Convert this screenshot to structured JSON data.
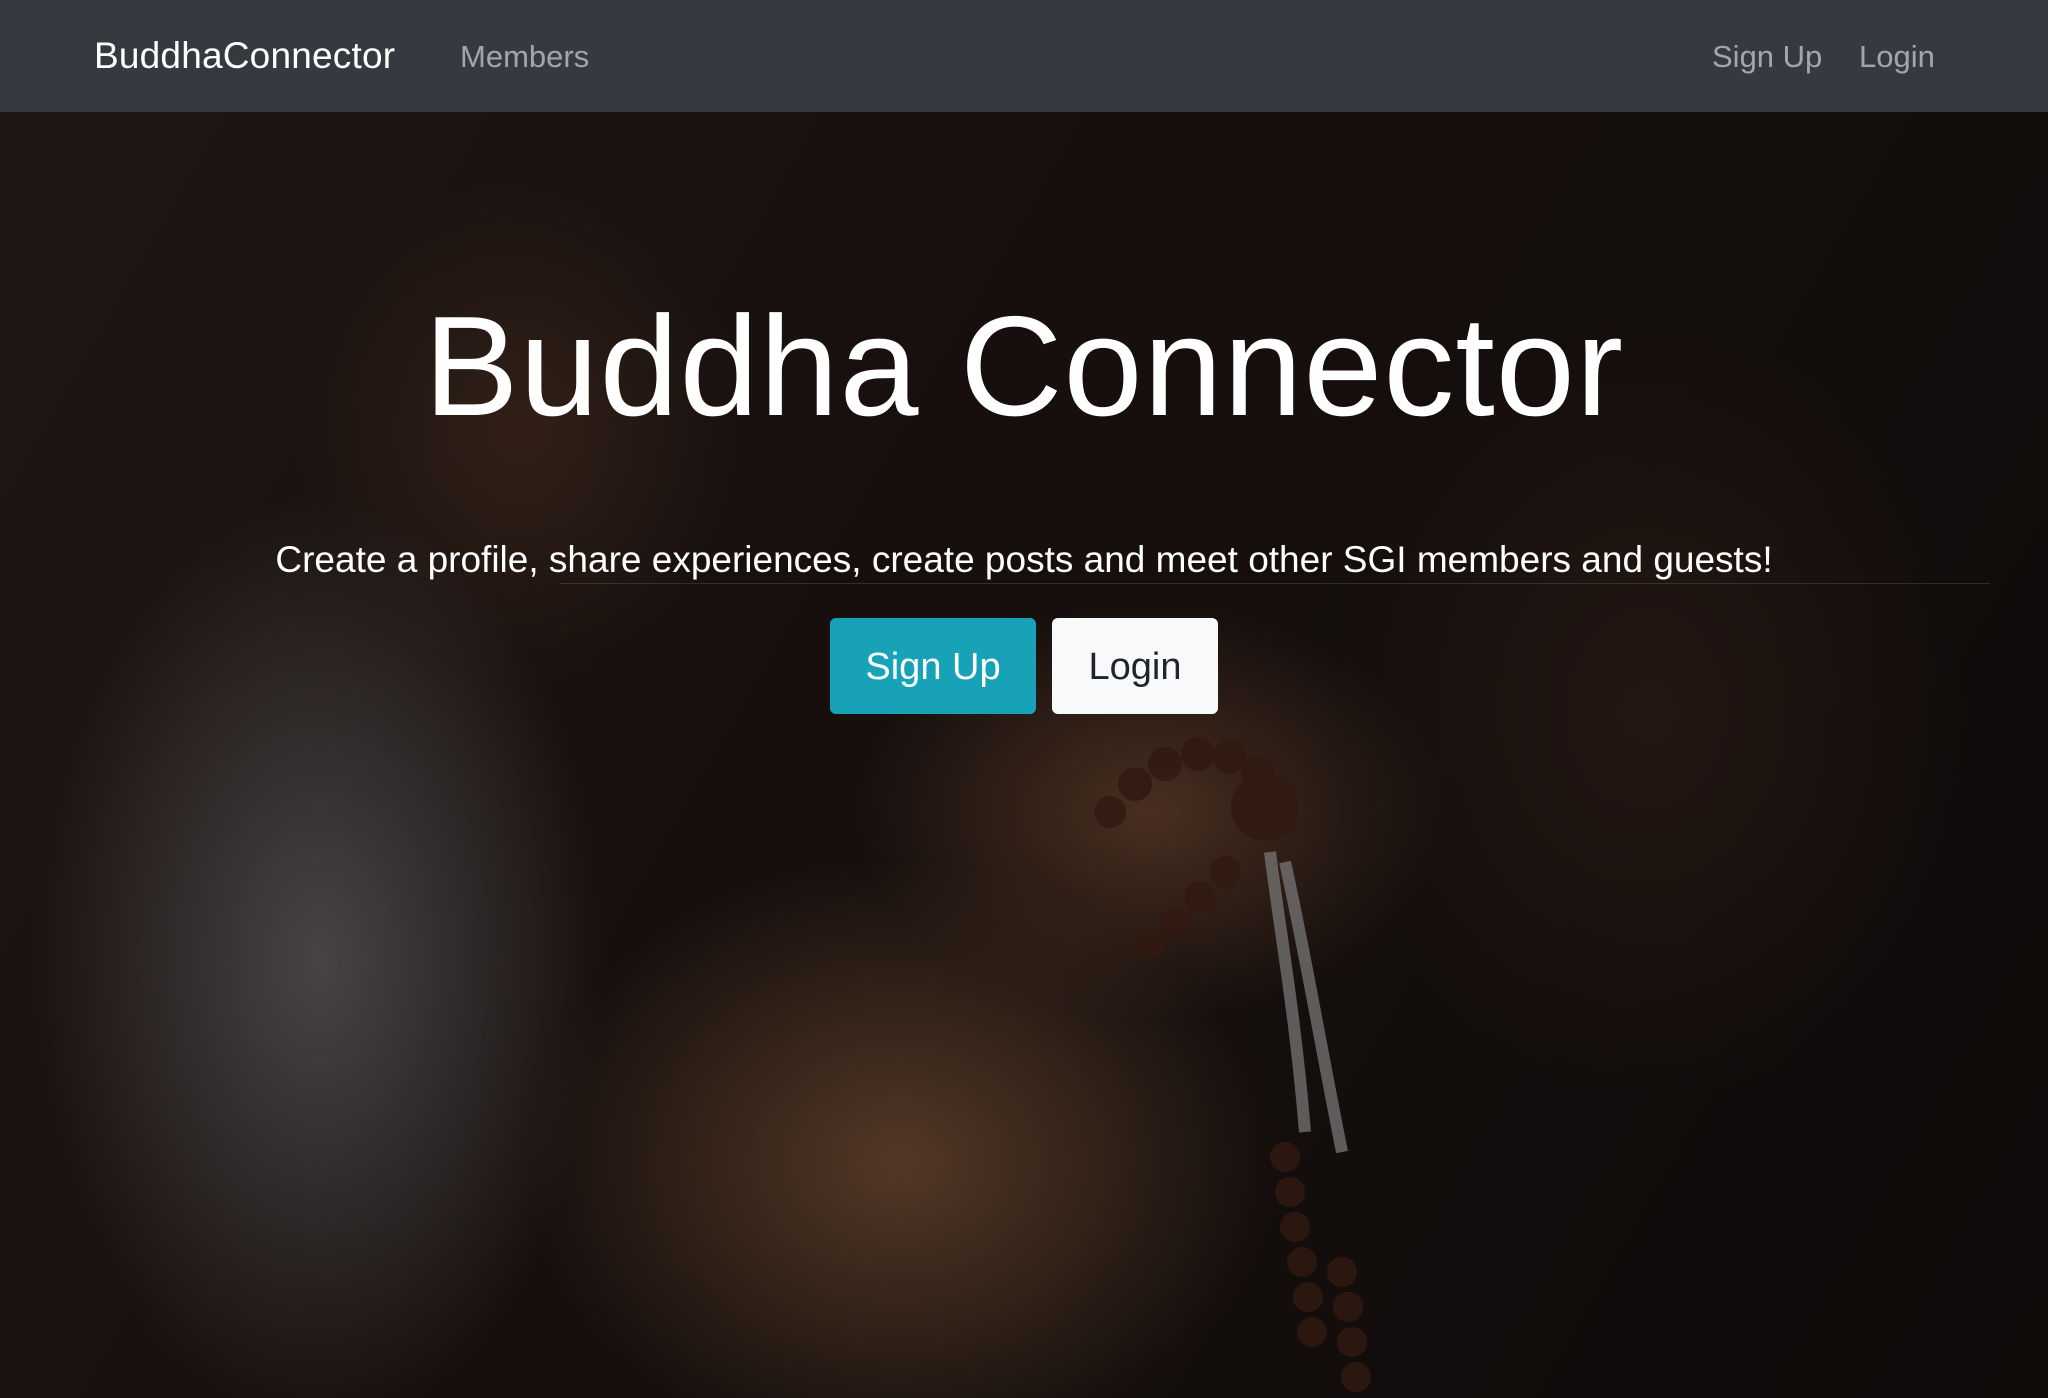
{
  "navbar": {
    "brand": "BuddhaConnector",
    "links": {
      "members": "Members",
      "sign_up": "Sign Up",
      "login": "Login"
    }
  },
  "hero": {
    "title": "Buddha Connector",
    "lead": "Create a profile, share experiences, create posts and meet other SGI members and guests!",
    "buttons": {
      "sign_up": "Sign Up",
      "login": "Login"
    },
    "background_image": "hands-holding-prayer-beads-photo"
  },
  "colors": {
    "navbar_bg": "#343a40",
    "accent": "#17a2b8",
    "light_button": "#f8f9fa"
  }
}
